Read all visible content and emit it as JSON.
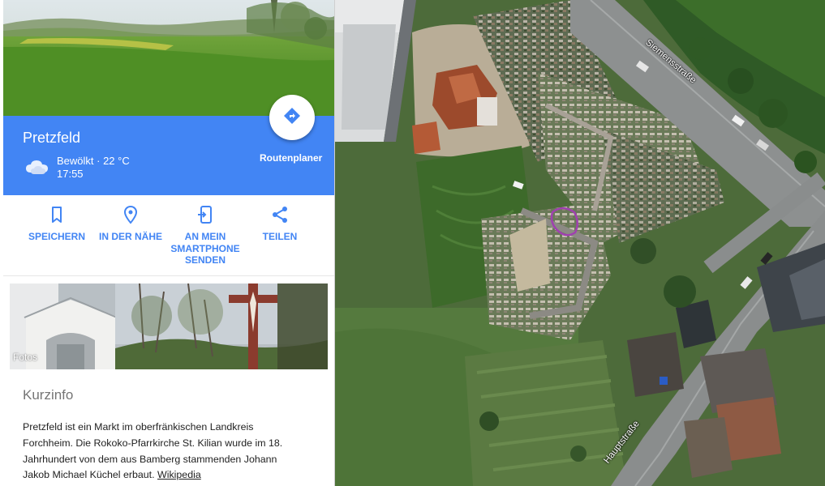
{
  "place": {
    "title": "Pretzfeld",
    "weather": "Bewölkt · 22 °C",
    "time": "17:55",
    "weather_icon": "cloudy-icon"
  },
  "route": {
    "label": "Routenplaner",
    "icon": "directions-icon"
  },
  "actions": [
    {
      "label": "SPEICHERN",
      "icon": "bookmark-icon"
    },
    {
      "label": "IN DER NÄHE",
      "icon": "nearby-pin-icon"
    },
    {
      "label": "AN MEIN SMARTPHONE SENDEN",
      "icon": "send-to-phone-icon"
    },
    {
      "label": "TEILEN",
      "icon": "share-icon"
    }
  ],
  "photos": {
    "label": "Fotos"
  },
  "info": {
    "title": "Kurzinfo",
    "text": "Pretzfeld ist ein Markt im oberfränkischen Landkreis Forchheim. Die Rokoko-Pfarrkirche St. Kilian wurde im 18. Jahrhundert von dem aus Bamberg stammenden Johann Jakob Michael Küchel erbaut.",
    "link": "Wikipedia"
  },
  "map": {
    "streets": [
      "Siemensstraße",
      "Hauptstraße"
    ],
    "colors": {
      "accent": "#4285f4",
      "marker": "#a040b0"
    }
  }
}
